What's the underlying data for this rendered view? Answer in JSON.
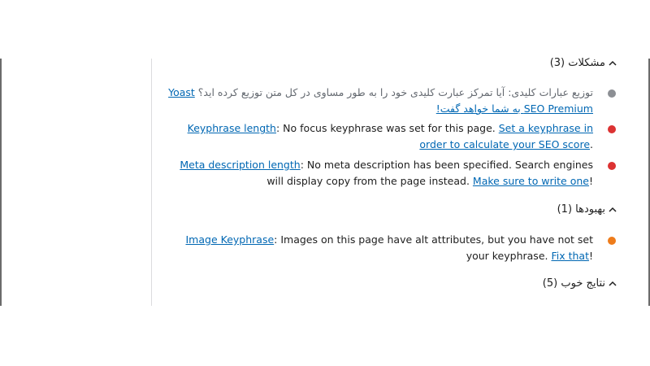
{
  "colors": {
    "gray": "#8c8f94",
    "red": "#dc3232",
    "orange": "#ee7c1b",
    "link": "#0067b3"
  },
  "sections": {
    "problems": {
      "title": "مشکلات (3)",
      "icon": "chevron-up-icon",
      "items": [
        {
          "status": "gray",
          "before": "توزیع عبارات کلیدی: آیا تمرکز عبارت کلیدی خود را به طور مساوی در کل متن توزیع کرده اید؟ ",
          "link": "Yoast SEO Premium به شما خواهد گفت!"
        },
        {
          "status": "red",
          "label": "Keyphrase length",
          "text": ": No focus keyphrase was set for this page. ",
          "link": "Set a keyphrase in order to calculate your SEO score",
          "after": "."
        },
        {
          "status": "red",
          "label": "Meta description length",
          "text": ": No meta description has been specified. Search engines will display copy from the page instead. ",
          "link": "Make sure to write one",
          "after": "!"
        }
      ]
    },
    "improvements": {
      "title": "بهبودها (1)",
      "icon": "chevron-up-icon",
      "items": [
        {
          "status": "orange",
          "label": "Image Keyphrase",
          "text": ": Images on this page have alt attributes, but you have not set your keyphrase. ",
          "link": "Fix that",
          "after": "!"
        }
      ]
    },
    "good": {
      "title": "نتایج خوب (5)",
      "icon": "chevron-up-icon"
    }
  }
}
